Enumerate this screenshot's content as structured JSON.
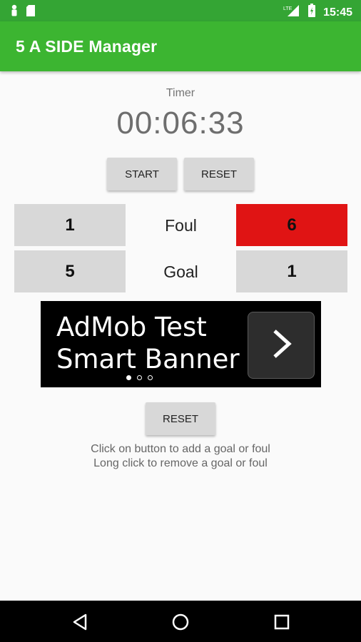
{
  "status_bar": {
    "time": "15:45",
    "icons": [
      "person-icon",
      "sd-card-icon",
      "lte-signal-icon",
      "battery-icon"
    ]
  },
  "app_bar": {
    "title": "5 A SIDE Manager",
    "color": "#3cb531"
  },
  "timer": {
    "label": "Timer",
    "value": "00:06:33",
    "start_label": "START",
    "reset_label": "RESET"
  },
  "scoreboard": {
    "rows": [
      {
        "label": "Foul",
        "left": "1",
        "right": "6",
        "right_highlight_color": "#e01414"
      },
      {
        "label": "Goal",
        "left": "5",
        "right": "1"
      }
    ]
  },
  "ad": {
    "line1": "AdMob Test",
    "line2": "Smart Banner",
    "arrow_icon": "chevron-right-icon",
    "pages": 3,
    "active_page": 1
  },
  "scores_reset_label": "RESET",
  "instructions": {
    "line1": "Click on button to add a goal or foul",
    "line2": "Long click to remove a goal or foul"
  },
  "nav": {
    "icons": [
      "back-icon",
      "home-icon",
      "recents-icon"
    ]
  }
}
